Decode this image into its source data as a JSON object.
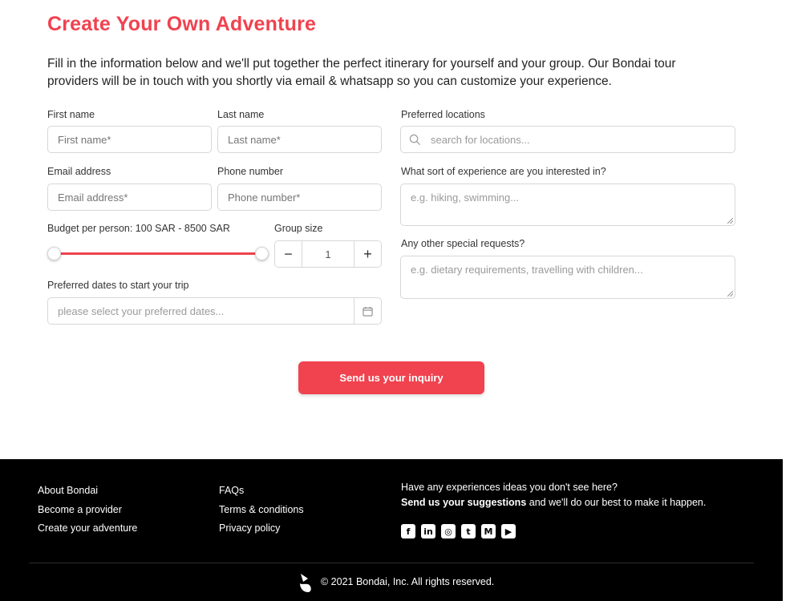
{
  "header": {
    "title": "Create Your Own Adventure",
    "intro": "Fill in the information below and we'll put together the perfect itinerary for yourself and your group. Our Bondai tour providers will be in touch with you shortly via email & whatsapp so you can customize your experience."
  },
  "form": {
    "first_name": {
      "label": "First name",
      "placeholder": "First name*"
    },
    "last_name": {
      "label": "Last name",
      "placeholder": "Last name*"
    },
    "email": {
      "label": "Email address",
      "placeholder": "Email address*"
    },
    "phone": {
      "label": "Phone number",
      "placeholder": "Phone number*"
    },
    "budget": {
      "label": "Budget per person: 100 SAR - 8500 SAR",
      "min_value": 100,
      "max_value": 8500,
      "currency": "SAR"
    },
    "group_size": {
      "label": "Group size",
      "value": "1",
      "minus": "−",
      "plus": "+"
    },
    "dates": {
      "label": "Preferred dates to start your trip",
      "placeholder": "please select your preferred dates..."
    },
    "locations": {
      "label": "Preferred locations",
      "placeholder": "search for locations..."
    },
    "experience": {
      "label": "What sort of experience are you interested in?",
      "placeholder": "e.g. hiking, swimming..."
    },
    "requests": {
      "label": "Any other special requests?",
      "placeholder": "e.g. dietary requirements, travelling with children..."
    },
    "submit_label": "Send us your inquiry"
  },
  "footer": {
    "col1": [
      "About Bondai",
      "Become a provider",
      "Create your adventure"
    ],
    "col2": [
      "FAQs",
      "Terms & conditions",
      "Privacy policy"
    ],
    "prompt": "Have any experiences ideas you don't see here?",
    "suggest_link": "Send us your suggestions",
    "suggest_rest": " and we'll do our best to make it happen.",
    "socials": [
      {
        "icon": "facebook-icon",
        "glyph": "f"
      },
      {
        "icon": "linkedin-icon",
        "glyph": "in"
      },
      {
        "icon": "instagram-icon",
        "glyph": "◎"
      },
      {
        "icon": "twitter-icon",
        "glyph": "t"
      },
      {
        "icon": "medium-icon",
        "glyph": "M"
      },
      {
        "icon": "youtube-icon",
        "glyph": "▶"
      }
    ],
    "copyright": "© 2021 Bondai, Inc. All rights reserved."
  },
  "colors": {
    "accent": "#f0424f",
    "footer_bg": "#000000"
  }
}
